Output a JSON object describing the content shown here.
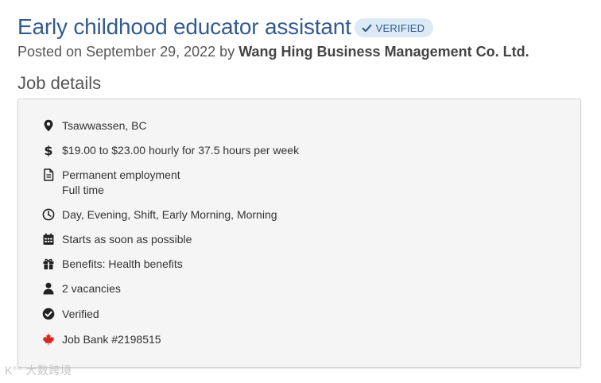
{
  "job": {
    "title": "Early childhood educator assistant",
    "badge": "VERIFIED",
    "posted_prefix": "Posted on September 29, 2022 by",
    "employer": "Wang Hing Business Management Co. Ltd."
  },
  "section_title": "Job details",
  "details": [
    {
      "icon": "location-icon",
      "lines": [
        "Tsawwassen, BC"
      ]
    },
    {
      "icon": "dollar-icon",
      "lines": [
        "$19.00 to $23.00 hourly for 37.5 hours per week"
      ]
    },
    {
      "icon": "document-icon",
      "lines": [
        "Permanent employment",
        "Full time"
      ]
    },
    {
      "icon": "clock-icon",
      "lines": [
        "Day, Evening, Shift, Early Morning, Morning"
      ]
    },
    {
      "icon": "calendar-icon",
      "lines": [
        "Starts as soon as possible"
      ]
    },
    {
      "icon": "gift-icon",
      "lines": [
        "Benefits: Health benefits"
      ]
    },
    {
      "icon": "person-icon",
      "lines": [
        "2 vacancies"
      ]
    },
    {
      "icon": "check-circle-icon",
      "lines": [
        "Verified"
      ]
    },
    {
      "icon": "maple-leaf-icon",
      "lines": [
        "Job Bank #2198515"
      ]
    }
  ],
  "watermark": "大数跨境",
  "colors": {
    "title": "#335b8e",
    "badge_bg": "#dceaf6",
    "maple_leaf": "#d52b1e",
    "box_bg": "#f5f5f5"
  }
}
